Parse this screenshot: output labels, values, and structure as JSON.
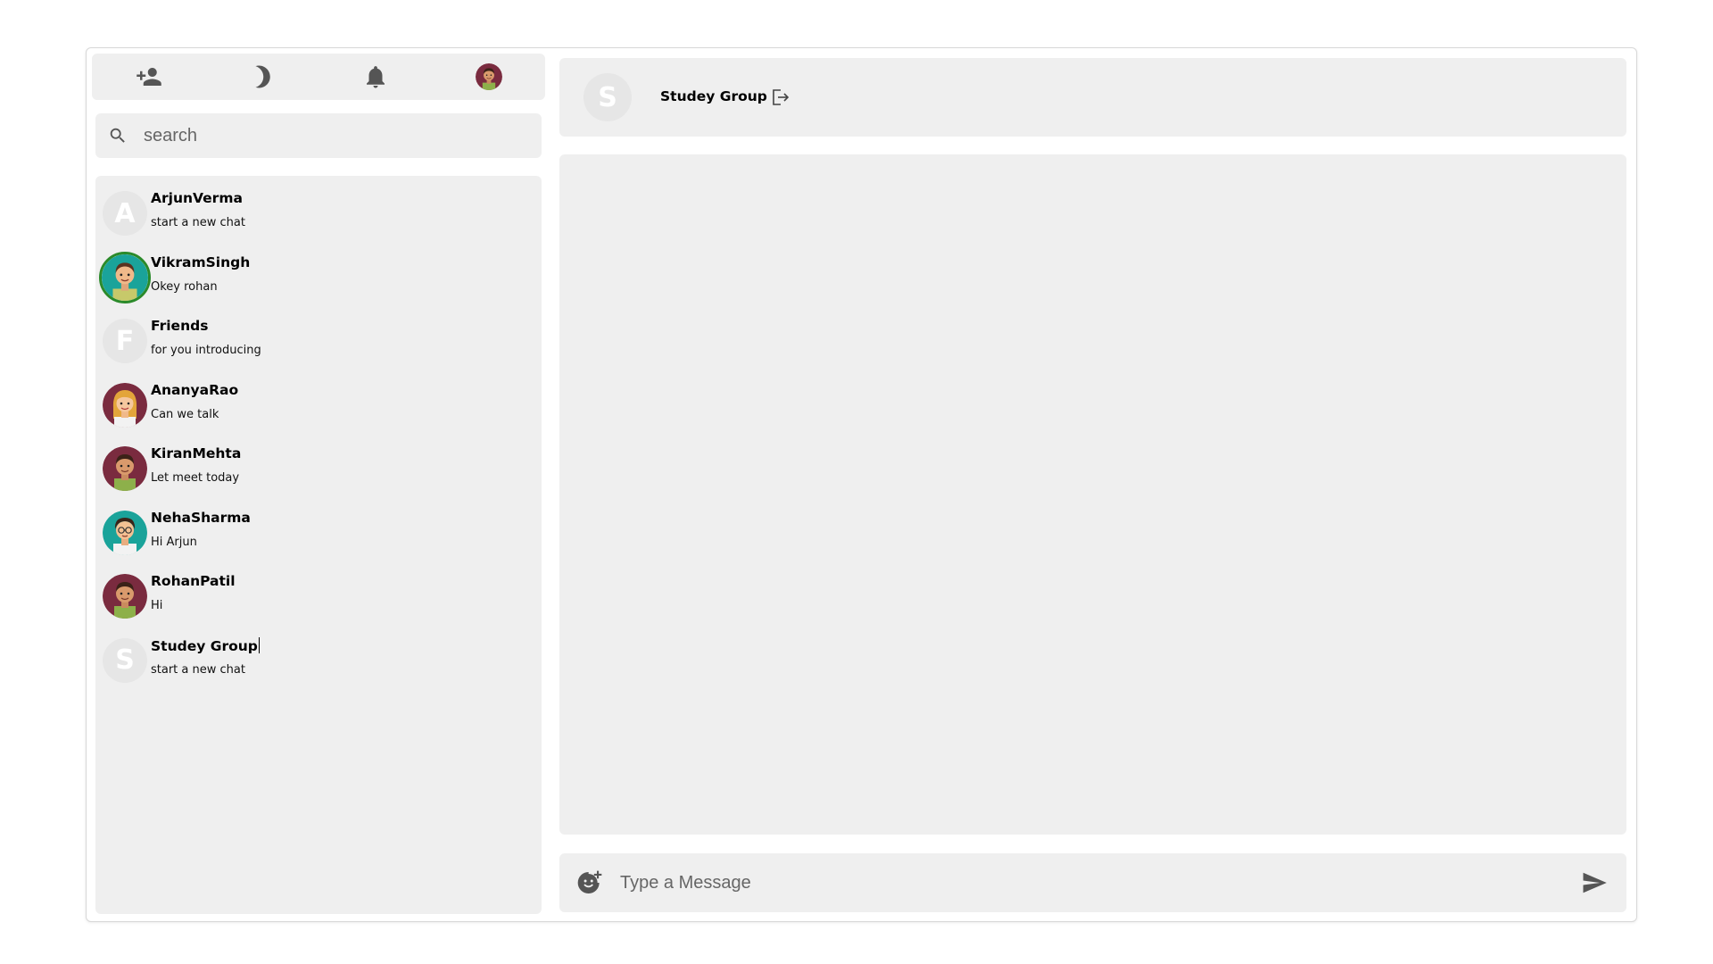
{
  "toolbar": {
    "icons": [
      "add-user-icon",
      "dark-mode-icon",
      "notifications-icon",
      "profile-avatar"
    ]
  },
  "search": {
    "placeholder": "search"
  },
  "contacts": [
    {
      "name": "ArjunVerma",
      "last_message": "start a new chat",
      "avatar": "A",
      "avatar_type": "letter"
    },
    {
      "name": "VikramSingh",
      "last_message": "Okey rohan",
      "avatar": "teal-boy",
      "avatar_type": "image",
      "online": true
    },
    {
      "name": "Friends",
      "last_message": "for you introducing",
      "avatar": "F",
      "avatar_type": "letter"
    },
    {
      "name": "AnanyaRao",
      "last_message": "Can we talk",
      "avatar": "maroon-girl",
      "avatar_type": "image"
    },
    {
      "name": "KiranMehta",
      "last_message": "Let meet today",
      "avatar": "maroon-boy",
      "avatar_type": "image"
    },
    {
      "name": "NehaSharma",
      "last_message": "Hi Arjun",
      "avatar": "teal-glasses",
      "avatar_type": "image"
    },
    {
      "name": "RohanPatil",
      "last_message": "Hi",
      "avatar": "maroon-boy",
      "avatar_type": "image"
    },
    {
      "name": "Studey Group",
      "last_message": "start a new chat",
      "avatar": "S",
      "avatar_type": "letter"
    }
  ],
  "chat": {
    "avatar": "S",
    "title": "Studey Group",
    "leave_icon": "exit-icon"
  },
  "composer": {
    "placeholder": "Type a Message",
    "emoji_icon": "add-emoji-icon",
    "send_icon": "send-icon"
  },
  "colors": {
    "panel": "#efefef",
    "online_ring": "#2a8a2a",
    "avatar_maroon": "#7a2b3f",
    "avatar_teal": "#1aa39a"
  }
}
